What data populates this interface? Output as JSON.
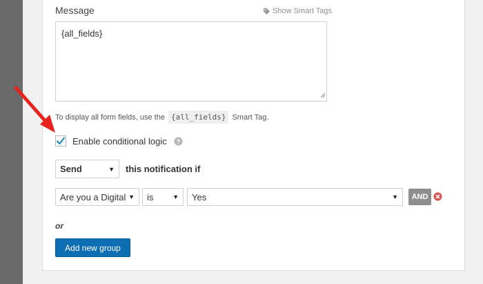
{
  "message_section": {
    "label": "Message",
    "smart_tags_link": "Show Smart Tags",
    "textarea_value": "{all_fields}",
    "help_prefix": "To display all form fields, use the",
    "help_code": "{all_fields}",
    "help_suffix": "Smart Tag."
  },
  "conditional": {
    "checkbox_label": "Enable conditional logic",
    "checked": true,
    "action_select": "Send",
    "action_suffix": "this notification if",
    "rule": {
      "field": "Are you a Digital",
      "operator": "is",
      "value": "Yes"
    },
    "and_label": "AND",
    "or_label": "or",
    "add_group_label": "Add new group"
  },
  "colors": {
    "accent_blue": "#0e6eb3",
    "checkmark": "#1e8cbe",
    "remove_red": "#d9534f",
    "annotation_arrow": "#e8231e"
  },
  "icons": {
    "smart_tags": "tag-icon",
    "help": "question-circle-icon",
    "remove": "close-circle-icon",
    "dropdown": "chevron-down-icon"
  }
}
